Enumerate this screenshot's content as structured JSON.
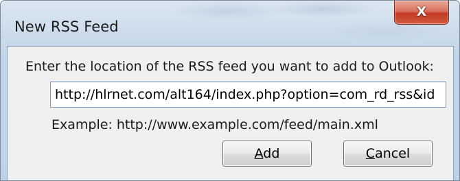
{
  "window": {
    "title": "New RSS Feed",
    "close_glyph": "X"
  },
  "dialog": {
    "prompt": "Enter the location of the RSS feed you want to add to Outlook:",
    "url_value": "http://hlrnet.com/alt164/index.php?option=com_rd_rss&id",
    "example": "Example: http://www.example.com/feed/main.xml"
  },
  "buttons": {
    "add": {
      "mnemonic": "A",
      "rest": "dd"
    },
    "cancel": {
      "mnemonic": "C",
      "rest": "ancel"
    }
  },
  "colors": {
    "close_button": "#c43a24",
    "dialog_face": "#f0f0f0",
    "frame": "#c2d5e8"
  },
  "icons": {
    "close": "close-icon"
  }
}
